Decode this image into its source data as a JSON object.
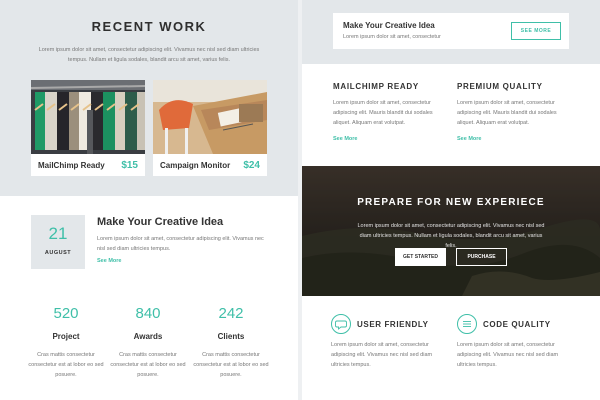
{
  "recent_work": {
    "title": "RECENT WORK",
    "description": "Lorem ipsum dolor sit amet, consectetur adipiscing elit. Vivamus nec nisl sed diam ultricies tempus. Nullam et ligula sodales, blandit arcu sit amet, varius felis.",
    "cards": [
      {
        "caption": "MailChimp Ready",
        "price": "$15"
      },
      {
        "caption": "Campaign Monitor",
        "price": "$24"
      }
    ]
  },
  "event": {
    "day": "21",
    "month": "AUGUST",
    "title": "Make Your Creative Idea",
    "text": "Lorem ipsum dolor sit amet, consectetur adipiscing elit. Vivamus nec nisl sed diam ultricies tempus.",
    "link": "See More"
  },
  "stats": [
    {
      "number": "520",
      "label": "Project",
      "text": "Cras mattis consectetur consectetur est at lobor eo sed posuere."
    },
    {
      "number": "840",
      "label": "Awards",
      "text": "Cras mattis consectetur consectetur est at lobor eo sed posuere."
    },
    {
      "number": "242",
      "label": "Clients",
      "text": "Cras mattis consectetur consectetur est at lobor eo sed posuere."
    }
  ],
  "banner": {
    "title": "Make Your Creative Idea",
    "subtitle": "Lorem ipsum dolor sit amet, consectetur",
    "button": "SEE MORE"
  },
  "features": [
    {
      "title": "MAILCHIMP READY",
      "text": "Lorem ipsum dolor sit amet, consectetur adipiscing elit. Mauris blandit dui sodales aliquet. Aliquam erat volutpat.",
      "link": "See More"
    },
    {
      "title": "PREMIUM QUALITY",
      "text": "Lorem ipsum dolor sit amet, consectetur adipiscing elit. Mauris blandit dui sodales aliquet. Aliquam erat volutpat.",
      "link": "See More"
    }
  ],
  "hero": {
    "title": "PREPARE FOR NEW EXPERIECE",
    "text": "Lorem ipsum dolor sit amet, consectetur adipiscing elit. Vivamus nec nisl sed diam ultricies tempus. Nullam et ligula sodales, blandit arcu sit amet, varius felis.",
    "primary_button": "GET STARTED",
    "secondary_button": "PURCHASE"
  },
  "footer_features": [
    {
      "icon": "chat-bubble-icon",
      "title": "USER FRIENDLY",
      "text": "Lorem ipsum dolor sit amet, consectetur adipiscing elit. Vivamus nec nisl sed diam ultricies tempus."
    },
    {
      "icon": "list-lines-icon",
      "title": "CODE QUALITY",
      "text": "Lorem ipsum dolor sit amet, consectetur adipiscing elit. Vivamus nec nisl sed diam ultricies tempus."
    }
  ],
  "colors": {
    "accent": "#3fbfa8",
    "panel": "#e3e7ea",
    "text": "#333333",
    "muted": "#777777"
  }
}
